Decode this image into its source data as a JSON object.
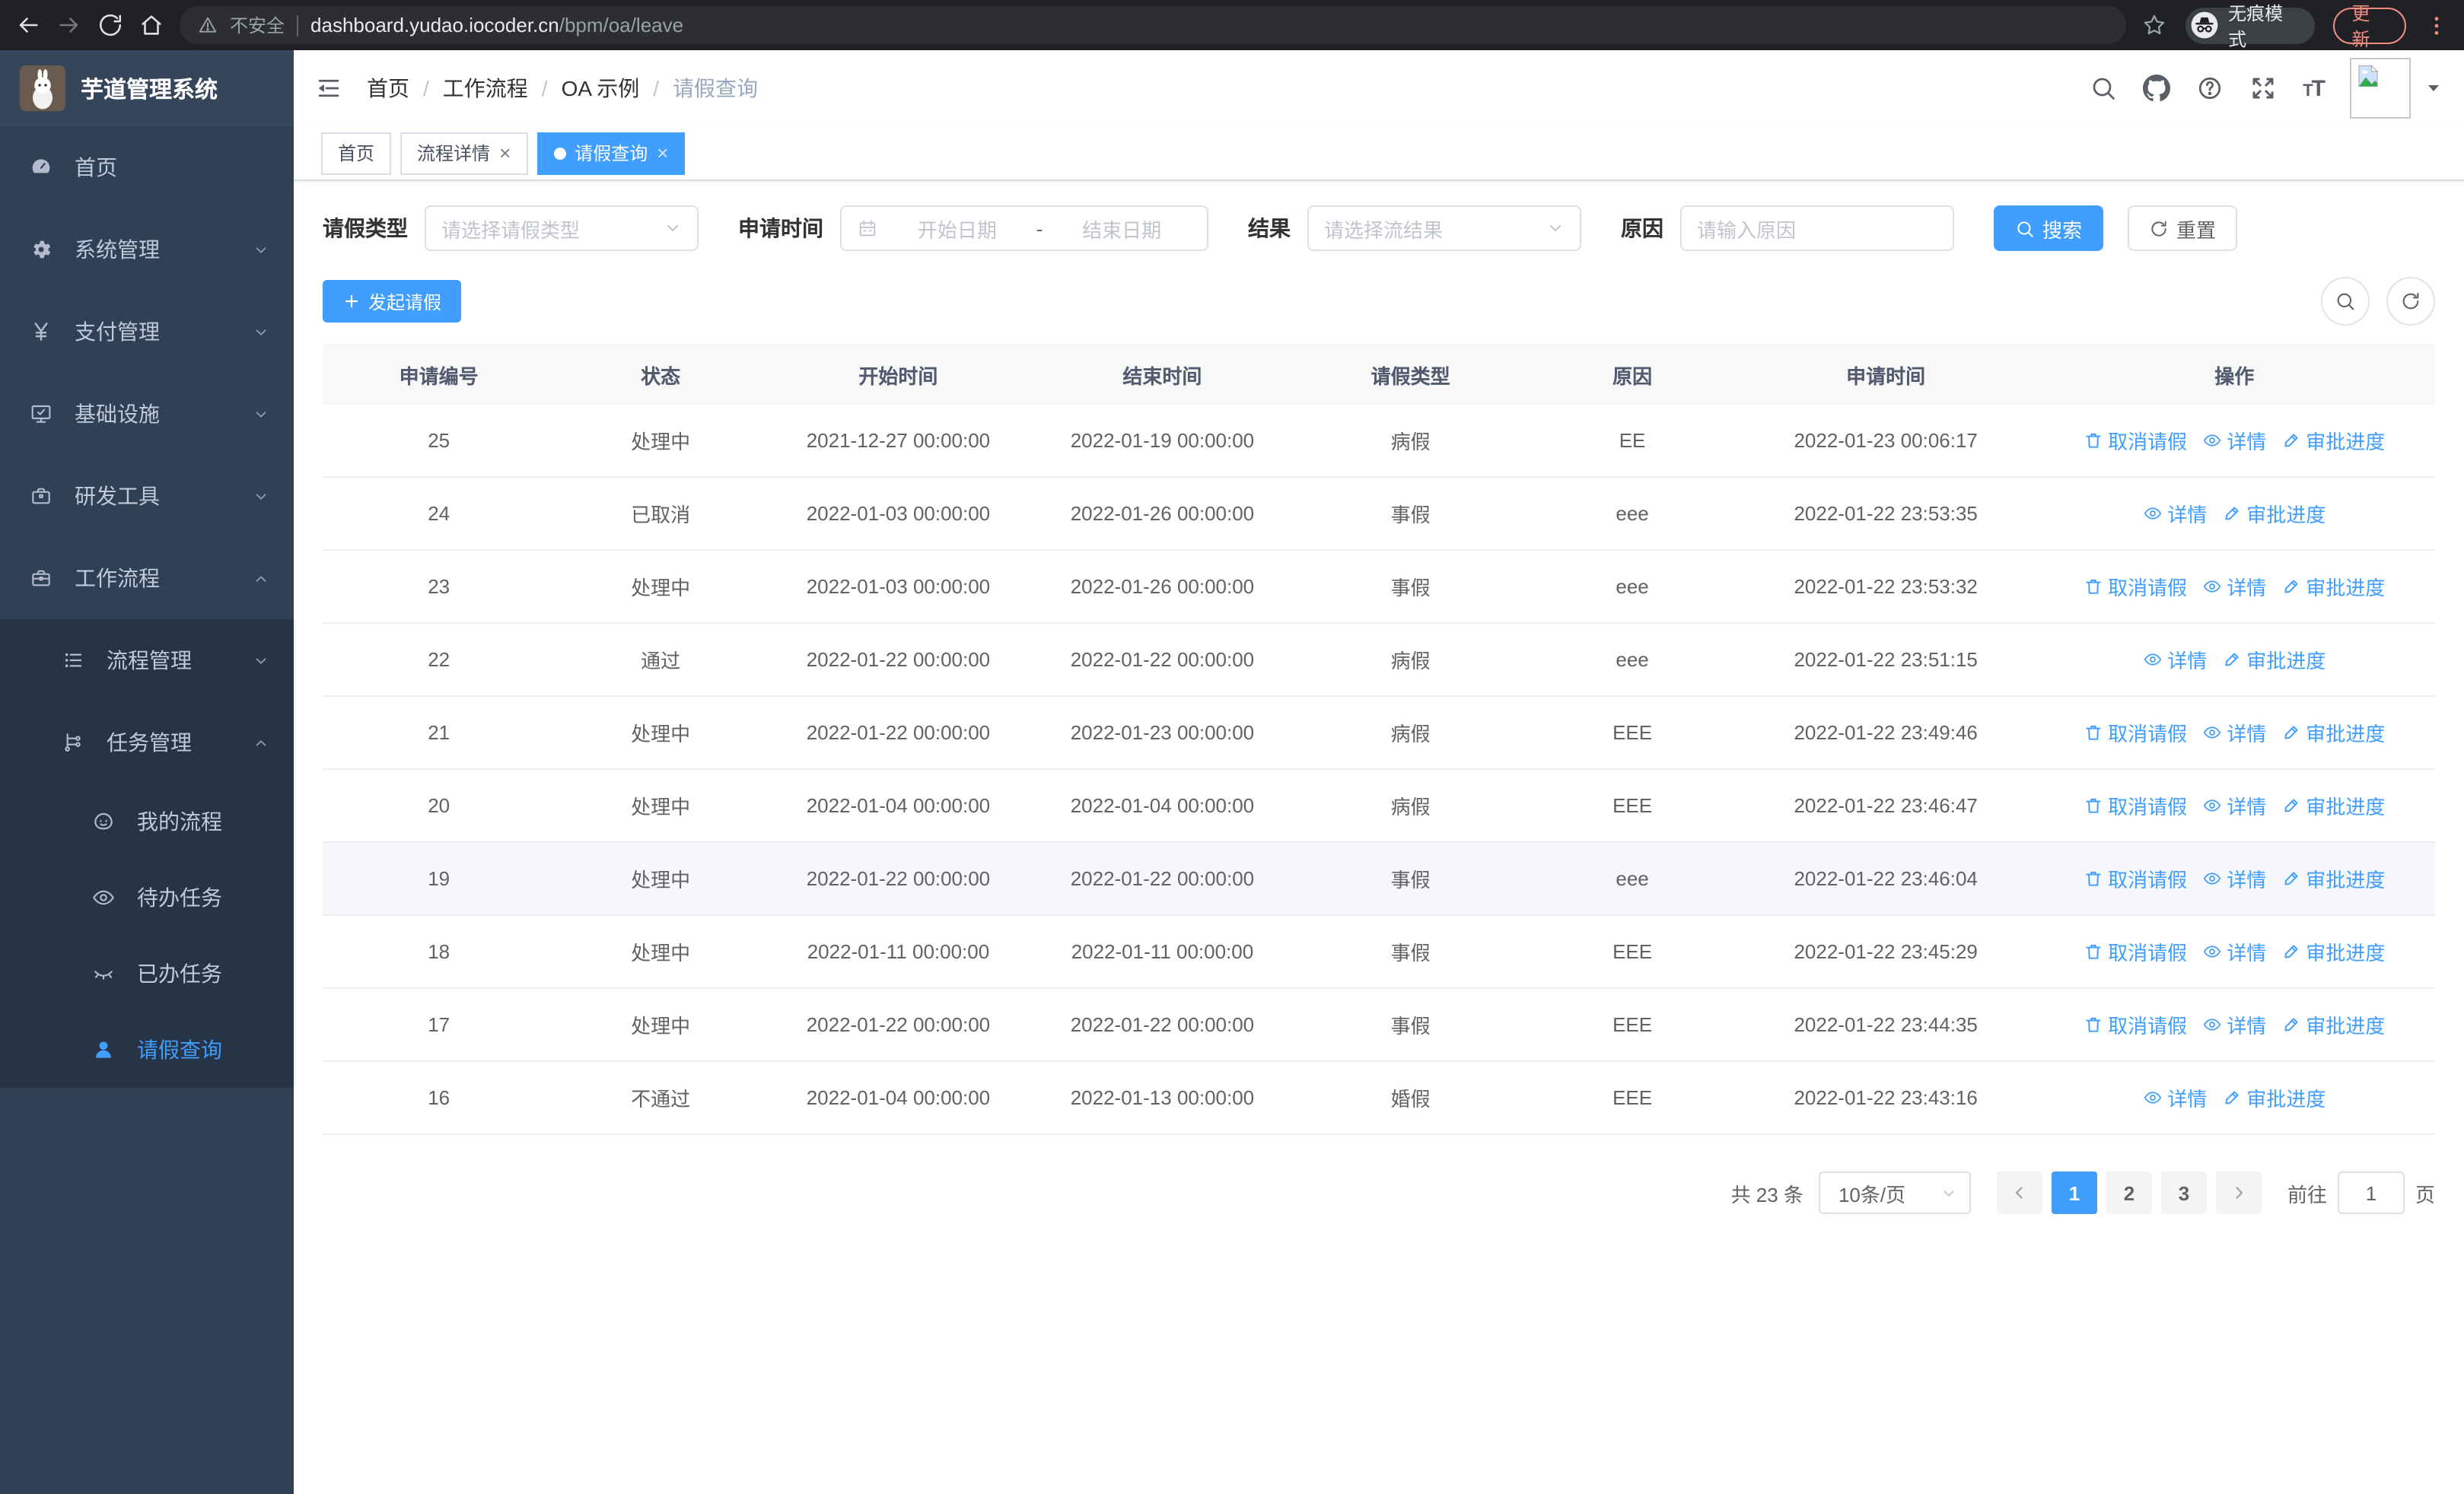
{
  "browser": {
    "security_label": "不安全",
    "url_domain": "dashboard.yudao.iocoder.cn",
    "url_path": "/bpm/oa/leave",
    "incognito_label": "无痕模式",
    "update_label": "更新"
  },
  "header": {
    "app_title": "芋道管理系统",
    "breadcrumb": [
      "首页",
      "工作流程",
      "OA 示例",
      "请假查询"
    ],
    "icons": [
      "search-icon",
      "github-icon",
      "help-icon",
      "fullscreen-icon",
      "font-size-icon",
      "avatar",
      "caret-down-icon"
    ]
  },
  "tabs": [
    {
      "label": "首页",
      "active": false,
      "closable": false
    },
    {
      "label": "流程详情",
      "active": false,
      "closable": true
    },
    {
      "label": "请假查询",
      "active": true,
      "closable": true
    }
  ],
  "sidebar": {
    "items": [
      {
        "id": "home",
        "label": "首页",
        "icon": "dashboard",
        "level": 0
      },
      {
        "id": "system",
        "label": "系统管理",
        "icon": "gear",
        "level": 0,
        "arrow": "down"
      },
      {
        "id": "payment",
        "label": "支付管理",
        "icon": "yen",
        "level": 0,
        "arrow": "down"
      },
      {
        "id": "infra",
        "label": "基础设施",
        "icon": "monitor",
        "level": 0,
        "arrow": "down"
      },
      {
        "id": "devtools",
        "label": "研发工具",
        "icon": "toolbox",
        "level": 0,
        "arrow": "down"
      },
      {
        "id": "workflow",
        "label": "工作流程",
        "icon": "briefcase",
        "level": 0,
        "arrow": "up"
      },
      {
        "id": "process-mgmt",
        "label": "流程管理",
        "icon": "list",
        "level": 1,
        "arrow": "down",
        "in_expanded": true
      },
      {
        "id": "task-mgmt",
        "label": "任务管理",
        "icon": "tree",
        "level": 1,
        "arrow": "up",
        "in_expanded": true
      },
      {
        "id": "my-process",
        "label": "我的流程",
        "icon": "face",
        "level": 2,
        "in_expanded": true
      },
      {
        "id": "todo-task",
        "label": "待办任务",
        "icon": "eye",
        "level": 2,
        "in_expanded": true
      },
      {
        "id": "done-task",
        "label": "已办任务",
        "icon": "eyeclosed",
        "level": 2,
        "in_expanded": true
      },
      {
        "id": "leave-query",
        "label": "请假查询",
        "icon": "user",
        "level": 2,
        "in_expanded": true,
        "active": true
      }
    ]
  },
  "filters": {
    "leave_type_label": "请假类型",
    "leave_type_placeholder": "请选择请假类型",
    "apply_time_label": "申请时间",
    "start_date_placeholder": "开始日期",
    "date_separator": "-",
    "end_date_placeholder": "结束日期",
    "result_label": "结果",
    "result_placeholder": "请选择流结果",
    "reason_label": "原因",
    "reason_placeholder": "请输入原因",
    "search_label": "搜索",
    "reset_label": "重置"
  },
  "toolbar": {
    "create_label": "发起请假"
  },
  "table": {
    "headers": [
      "申请编号",
      "状态",
      "开始时间",
      "结束时间",
      "请假类型",
      "原因",
      "申请时间",
      "操作"
    ],
    "action_labels": {
      "cancel": "取消请假",
      "detail": "详情",
      "progress": "审批进度"
    },
    "rows": [
      {
        "id": "25",
        "status": "处理中",
        "start": "2021-12-27 00:00:00",
        "end": "2022-01-19 00:00:00",
        "type": "病假",
        "reason": "EE",
        "apply_time": "2022-01-23 00:06:17",
        "actions": [
          "cancel",
          "detail",
          "progress"
        ]
      },
      {
        "id": "24",
        "status": "已取消",
        "start": "2022-01-03 00:00:00",
        "end": "2022-01-26 00:00:00",
        "type": "事假",
        "reason": "eee",
        "apply_time": "2022-01-22 23:53:35",
        "actions": [
          "detail",
          "progress"
        ]
      },
      {
        "id": "23",
        "status": "处理中",
        "start": "2022-01-03 00:00:00",
        "end": "2022-01-26 00:00:00",
        "type": "事假",
        "reason": "eee",
        "apply_time": "2022-01-22 23:53:32",
        "actions": [
          "cancel",
          "detail",
          "progress"
        ]
      },
      {
        "id": "22",
        "status": "通过",
        "start": "2022-01-22 00:00:00",
        "end": "2022-01-22 00:00:00",
        "type": "病假",
        "reason": "eee",
        "apply_time": "2022-01-22 23:51:15",
        "actions": [
          "detail",
          "progress"
        ]
      },
      {
        "id": "21",
        "status": "处理中",
        "start": "2022-01-22 00:00:00",
        "end": "2022-01-23 00:00:00",
        "type": "病假",
        "reason": "EEE",
        "apply_time": "2022-01-22 23:49:46",
        "actions": [
          "cancel",
          "detail",
          "progress"
        ]
      },
      {
        "id": "20",
        "status": "处理中",
        "start": "2022-01-04 00:00:00",
        "end": "2022-01-04 00:00:00",
        "type": "病假",
        "reason": "EEE",
        "apply_time": "2022-01-22 23:46:47",
        "actions": [
          "cancel",
          "detail",
          "progress"
        ]
      },
      {
        "id": "19",
        "status": "处理中",
        "start": "2022-01-22 00:00:00",
        "end": "2022-01-22 00:00:00",
        "type": "事假",
        "reason": "eee",
        "apply_time": "2022-01-22 23:46:04",
        "actions": [
          "cancel",
          "detail",
          "progress"
        ],
        "highlighted": true
      },
      {
        "id": "18",
        "status": "处理中",
        "start": "2022-01-11 00:00:00",
        "end": "2022-01-11 00:00:00",
        "type": "事假",
        "reason": "EEE",
        "apply_time": "2022-01-22 23:45:29",
        "actions": [
          "cancel",
          "detail",
          "progress"
        ]
      },
      {
        "id": "17",
        "status": "处理中",
        "start": "2022-01-22 00:00:00",
        "end": "2022-01-22 00:00:00",
        "type": "事假",
        "reason": "EEE",
        "apply_time": "2022-01-22 23:44:35",
        "actions": [
          "cancel",
          "detail",
          "progress"
        ]
      },
      {
        "id": "16",
        "status": "不通过",
        "start": "2022-01-04 00:00:00",
        "end": "2022-01-13 00:00:00",
        "type": "婚假",
        "reason": "EEE",
        "apply_time": "2022-01-22 23:43:16",
        "actions": [
          "detail",
          "progress"
        ]
      }
    ]
  },
  "pagination": {
    "total_label": "共 23 条",
    "page_size": "10条/页",
    "pages": [
      "1",
      "2",
      "3"
    ],
    "current_page": "1",
    "goto_label": "前往",
    "goto_value": "1",
    "page_unit": "页"
  },
  "colors": {
    "primary": "#409eff",
    "sidebar_bg": "#304156",
    "sidebar_sub_bg": "#263445",
    "update_accent": "#f28b82"
  }
}
